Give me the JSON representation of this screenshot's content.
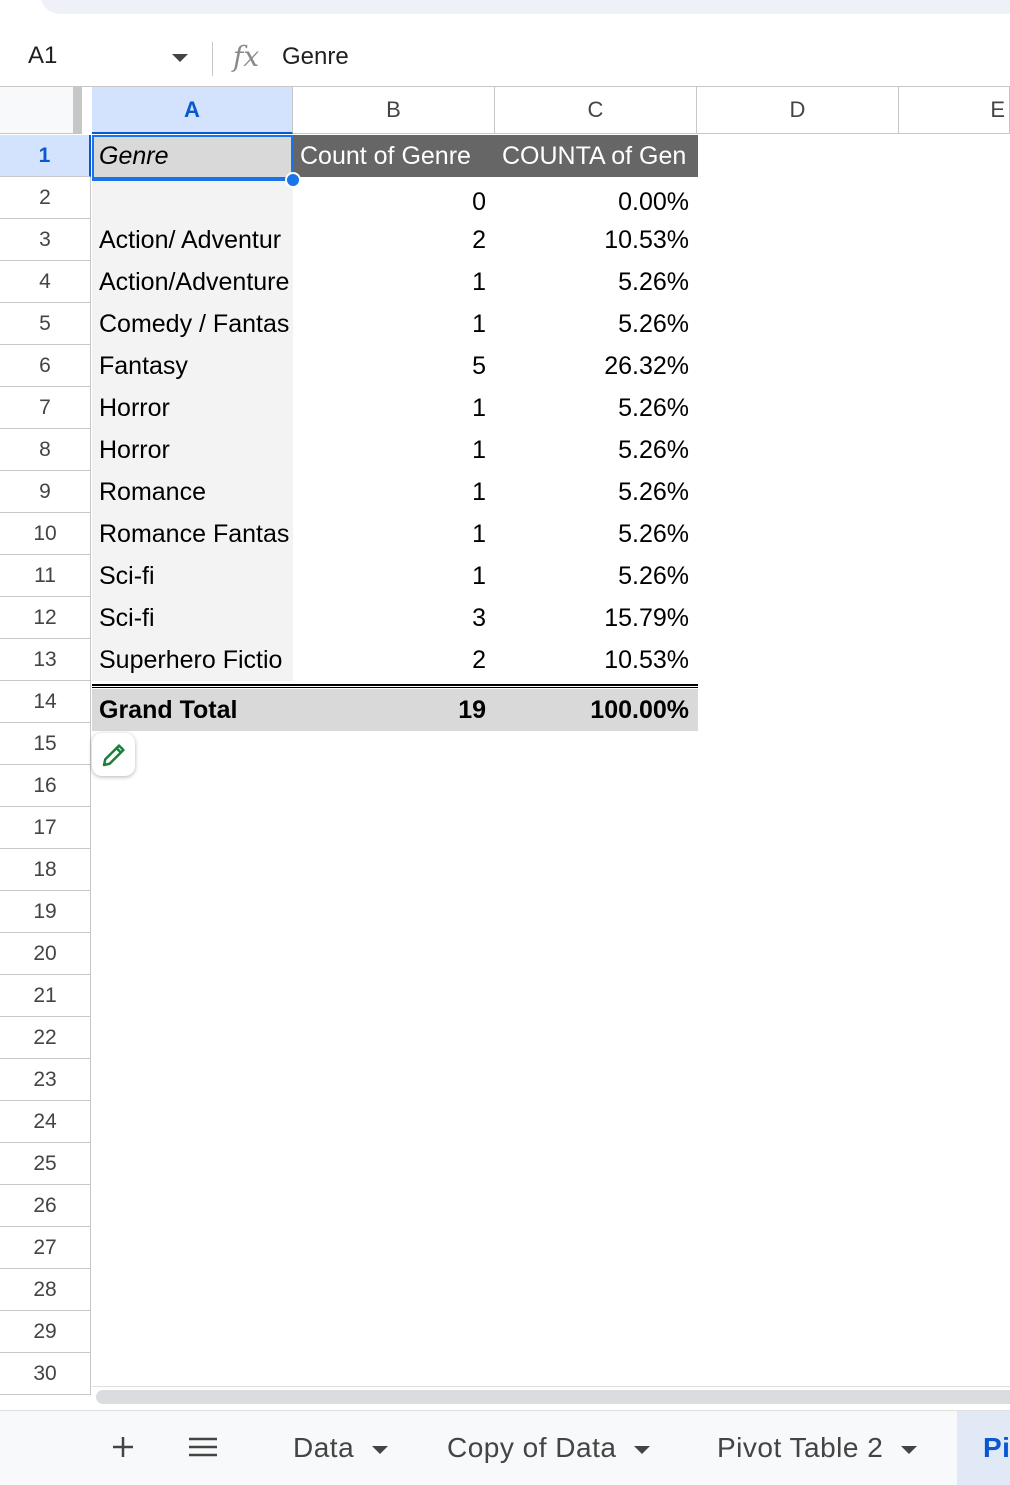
{
  "formula_bar": {
    "cell_ref": "A1",
    "fx_symbol": "fx",
    "value": "Genre"
  },
  "columns": [
    "A",
    "B",
    "C",
    "D",
    "E"
  ],
  "rows": [
    "1",
    "2",
    "3",
    "4",
    "5",
    "6",
    "7",
    "8",
    "9",
    "10",
    "11",
    "12",
    "13",
    "14",
    "15",
    "16",
    "17",
    "18",
    "19",
    "20",
    "21",
    "22",
    "23",
    "24",
    "25",
    "26",
    "27",
    "28",
    "29",
    "30"
  ],
  "pivot": {
    "headers": {
      "genre": "Genre",
      "count": "Count of Genre",
      "counta": "COUNTA of Gen"
    },
    "rows": [
      {
        "genre": "",
        "count": "0",
        "pct": "0.00%"
      },
      {
        "genre": "Action/ Adventur",
        "count": "2",
        "pct": "10.53%"
      },
      {
        "genre": "Action/Adventure",
        "count": "1",
        "pct": "5.26%"
      },
      {
        "genre": "Comedy / Fantas",
        "count": "1",
        "pct": "5.26%"
      },
      {
        "genre": "Fantasy",
        "count": "5",
        "pct": "26.32%"
      },
      {
        "genre": "Horror",
        "count": "1",
        "pct": "5.26%"
      },
      {
        "genre": "Horror",
        "count": "1",
        "pct": "5.26%"
      },
      {
        "genre": "Romance",
        "count": "1",
        "pct": "5.26%"
      },
      {
        "genre": "Romance Fantas",
        "count": "1",
        "pct": "5.26%"
      },
      {
        "genre": "Sci-fi",
        "count": "1",
        "pct": "5.26%"
      },
      {
        "genre": "Sci-fi",
        "count": "3",
        "pct": "15.79%"
      },
      {
        "genre": "Superhero Fictio",
        "count": "2",
        "pct": "10.53%"
      }
    ],
    "total": {
      "label": "Grand Total",
      "count": "19",
      "pct": "100.00%"
    }
  },
  "sheet_tabs": {
    "add_icon": "plus-icon",
    "menu_icon": "hamburger-icon",
    "tabs": [
      "Data",
      "Copy of Data",
      "Pivot Table 2",
      "Pi"
    ]
  },
  "colors": {
    "accent": "#0b57d0",
    "pivot_header": "#666666",
    "total_bg": "#d9d9d9"
  }
}
